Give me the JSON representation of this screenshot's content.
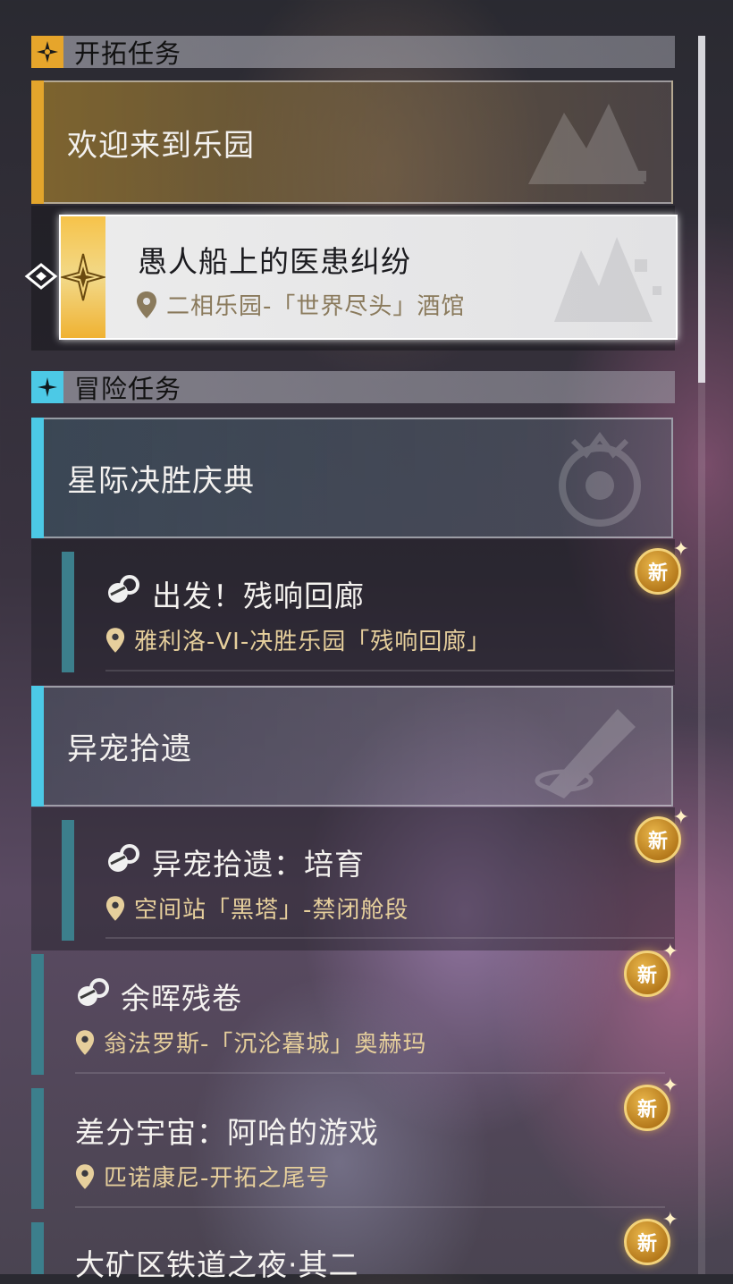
{
  "sections": {
    "trailblaze": {
      "title": "开拓任务"
    },
    "adventure": {
      "title": "冒险任务"
    }
  },
  "trailblaze_group": {
    "label": "欢迎来到乐园"
  },
  "selected_quest": {
    "title": "愚人船上的医患纠纷",
    "location": "二相乐园-「世界尽头」酒馆"
  },
  "adventure_groups": [
    {
      "label": "星际决胜庆典"
    },
    {
      "label": "异宠拾遗"
    }
  ],
  "quests": [
    {
      "title": "出发！残响回廊",
      "location": "雅利洛-VI-决胜乐园「残响回廊」",
      "badge": "新"
    },
    {
      "title": "异宠拾遗：培育",
      "location": "空间站「黑塔」-禁闭舱段",
      "badge": "新"
    },
    {
      "title": "余晖残卷",
      "location": "翁法罗斯-「沉沦暮城」奥赫玛",
      "badge": "新"
    },
    {
      "title": "差分宇宙：阿哈的游戏",
      "location": "匹诺康尼-开拓之尾号",
      "badge": "新"
    },
    {
      "title": "大矿区铁道之夜·其二",
      "badge": "新"
    }
  ],
  "colors": {
    "trailblaze_accent": "#e3a52c",
    "adventure_accent": "#4cc9e6",
    "quest_bar": "#3c7f8c",
    "location_text": "#e6cf9c",
    "badge": "#c98a22"
  },
  "icons": {
    "trailblaze": "compass-star-icon",
    "adventure": "sparkle-icon",
    "quest_type": "quest-type-icon",
    "location": "location-pin-icon",
    "selection": "selection-arrow-icon"
  }
}
